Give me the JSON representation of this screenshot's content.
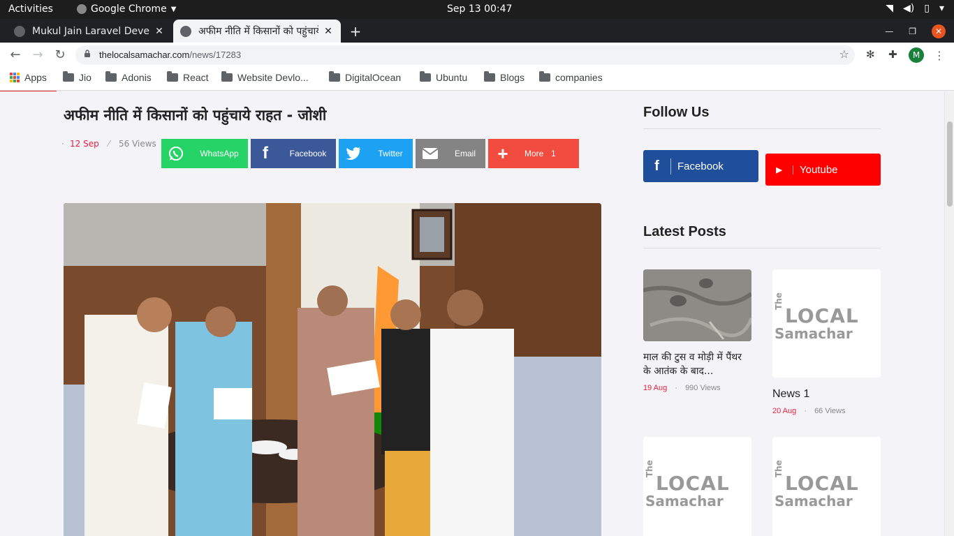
{
  "system": {
    "activities": "Activities",
    "app_name": "Google Chrome",
    "clock": "Sep 13  00:47"
  },
  "tabs": [
    {
      "title": "Mukul Jain Laravel Develo",
      "active": false
    },
    {
      "title": "अफीम नीति में किसानों को पहुंचाये",
      "active": true
    }
  ],
  "address": {
    "host": "thelocalsamachar.com",
    "path": "/news/17283"
  },
  "profile_initial": "M",
  "bookmarks": [
    "Apps",
    "Jio",
    "Adonis",
    "React",
    "Website Devlo...",
    "DigitalOcean",
    "Ubuntu",
    "Blogs",
    "companies"
  ],
  "article": {
    "title": "अफीम नीति में किसानों को पहुंचाये राहत - जोशी",
    "date": "12 Sep",
    "views": "56 Views"
  },
  "share_buttons": [
    {
      "label": "WhatsApp",
      "color": "#25d366",
      "icon": "whatsapp-icon"
    },
    {
      "label": "Facebook",
      "color": "#3b5998",
      "icon": "facebook-icon"
    },
    {
      "label": "Twitter",
      "color": "#1da1f2",
      "icon": "twitter-icon"
    },
    {
      "label": "Email",
      "color": "#848484",
      "icon": "email-icon"
    },
    {
      "label": "More",
      "count": "1",
      "color": "#f24b3f",
      "icon": "plus-icon"
    }
  ],
  "sidebar": {
    "follow_heading": "Follow Us",
    "facebook_label": "Facebook",
    "youtube_label": "Youtube",
    "latest_heading": "Latest Posts",
    "posts": [
      {
        "title": "माल की टुस व मोड़ी में पैंथर के आतंक के बाद...",
        "date": "19 Aug",
        "views": "990 Views"
      },
      {
        "title": "News 1",
        "date": "20 Aug",
        "views": "66 Views"
      }
    ],
    "logo_text": {
      "the": "The",
      "local": "LOCAL",
      "samachar": "Samachar"
    }
  },
  "colors": {
    "accent": "#e91e3c",
    "facebook": "#1f4f9a",
    "youtube": "#ff0000"
  }
}
